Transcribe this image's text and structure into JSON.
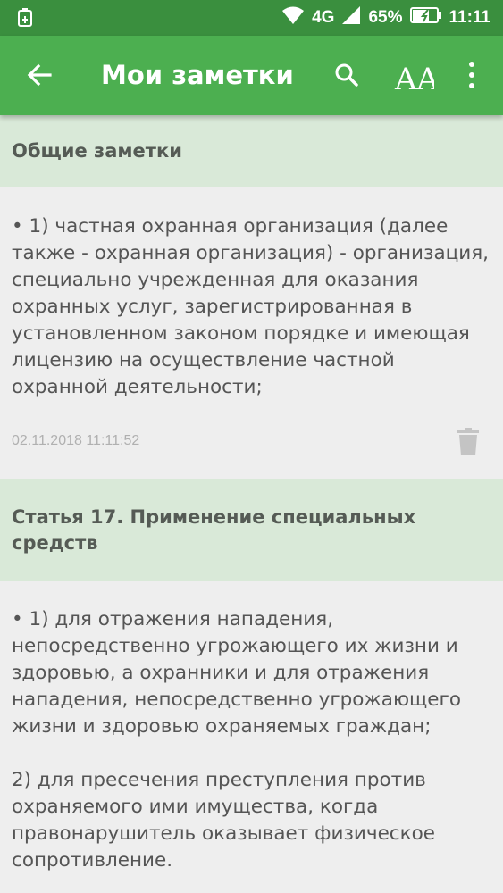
{
  "status_bar": {
    "network": "4G",
    "battery": "65%",
    "time": "11:11",
    "icons": [
      "usb-debug-icon",
      "wifi-icon",
      "signal-icon",
      "battery-icon"
    ]
  },
  "app_bar": {
    "title": "Мои заметки",
    "background": "#4caf50",
    "icons": [
      "back-arrow-icon",
      "search-icon",
      "font-size-icon",
      "more-vert-icon"
    ],
    "font_button_label": "AA"
  },
  "notes": [
    {
      "header": "Общие заметки",
      "text": "• 1) частная охранная организация (далее также - охранная организация) - организация, специально учрежденная для оказания охранных услуг, зарегистрированная в установленном законом порядке и имеющая лицензию на осуществление частной охранной деятельности;",
      "date": "02.11.2018 11:11:52"
    },
    {
      "header": "Статья 17. Применение специальных средств",
      "text": "• 1) для отражения нападения, непосредственно угрожающего их жизни и здоровью, а охранники и для отражения нападения, непосредственно угрожающего жизни и здоровью охраняемых граждан;\n\n2) для пресечения преступления против охраняемого ими имущества, когда правонарушитель оказывает физическое сопротивление."
    }
  ]
}
